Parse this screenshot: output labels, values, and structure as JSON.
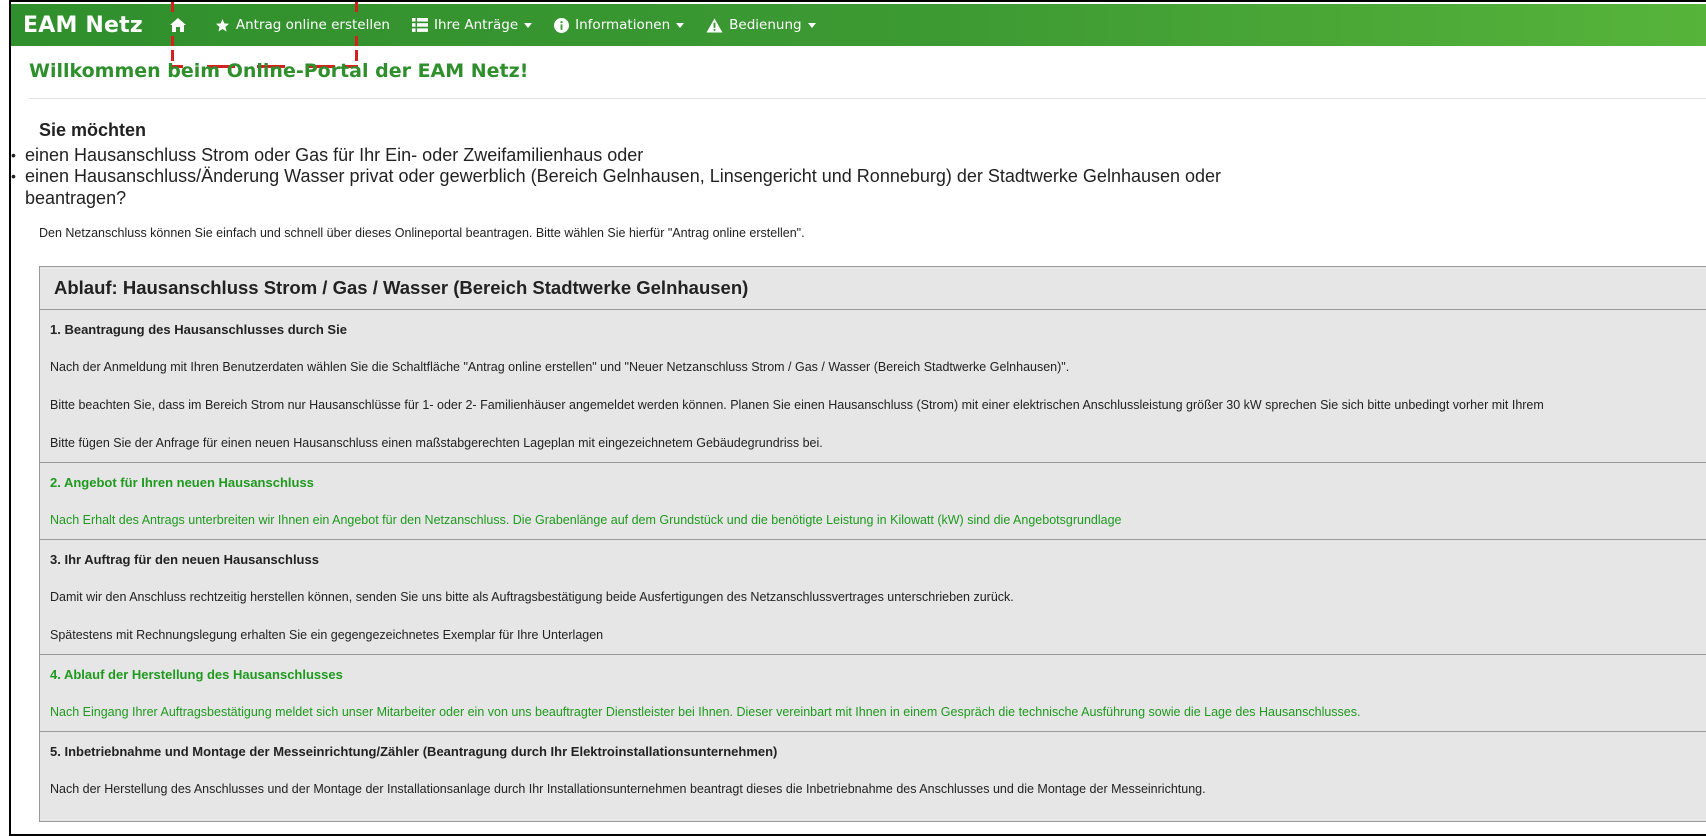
{
  "navbar": {
    "brand": "EAM Netz",
    "items": [
      {
        "icon": "star-icon",
        "label": "Antrag online erstellen"
      },
      {
        "icon": "list-icon",
        "label": "Ihre Anträge"
      },
      {
        "icon": "info-icon",
        "label": "Informationen"
      },
      {
        "icon": "warning-icon",
        "label": "Bedienung"
      }
    ]
  },
  "page": {
    "title": "Willkommen beim Online-Portal der EAM Netz!",
    "intro_heading": "Sie möchten",
    "intro_items": [
      "einen Hausanschluss Strom oder Gas für Ihr Ein- oder Zweifamilienhaus oder",
      "einen Hausanschluss/Änderung Wasser privat oder gewerblich (Bereich Gelnhausen, Linsengericht und Ronneburg) der Stadtwerke Gelnhausen oder"
    ],
    "intro_end": "beantragen?",
    "note": "Den Netzanschluss können Sie einfach und schnell über dieses Onlineportal beantragen. Bitte wählen Sie hierfür \"Antrag online erstellen\"."
  },
  "panel": {
    "title": "Ablauf: Hausanschluss Strom / Gas / Wasser (Bereich Stadtwerke Gelnhausen)",
    "steps": [
      {
        "title": "1. Beantragung des Hausanschlusses durch Sie",
        "paragraphs": [
          "Nach der Anmeldung mit Ihren Benutzerdaten wählen Sie die Schaltfläche \"Antrag online erstellen\" und \"Neuer Netzanschluss Strom / Gas / Wasser (Bereich Stadtwerke Gelnhausen)\".",
          "Bitte beachten Sie, dass im Bereich Strom nur Hausanschlüsse für 1- oder 2- Familienhäuser angemeldet werden können. Planen Sie einen Hausanschluss (Strom) mit einer elektrischen Anschlussleistung größer 30 kW sprechen Sie sich bitte unbedingt vorher mit Ihrem",
          "Bitte fügen Sie der Anfrage für einen neuen Hausanschluss einen maßstabgerechten Lageplan mit eingezeichnetem Gebäudegrundriss bei."
        ]
      },
      {
        "title": "2. Angebot für Ihren neuen Hausanschluss",
        "paragraphs": [
          "Nach Erhalt des Antrags unterbreiten wir Ihnen ein Angebot für den Netzanschluss. Die Grabenlänge auf dem Grundstück und die benötigte Leistung in Kilowatt (kW) sind die Angebotsgrundlage"
        ]
      },
      {
        "title": "3. Ihr Auftrag für den neuen Hausanschluss",
        "paragraphs": [
          "Damit wir den Anschluss rechtzeitig herstellen können, senden Sie uns bitte als Auftragsbestätigung beide Ausfertigungen des Netzanschlussvertrages unterschrieben zurück.",
          "Spätestens mit Rechnungslegung erhalten Sie ein gegengezeichnetes Exemplar für Ihre Unterlagen"
        ]
      },
      {
        "title": "4. Ablauf der Herstellung des Hausanschlusses",
        "paragraphs": [
          "Nach Eingang Ihrer Auftragsbestätigung meldet sich unser Mitarbeiter oder ein von uns beauftragter Dienstleister bei Ihnen. Dieser vereinbart mit Ihnen in einem Gespräch die technische Ausführung sowie die Lage des Hausanschlusses."
        ]
      },
      {
        "title": "5. Inbetriebnahme und Montage der Messeinrichtung/Zähler (Beantragung durch Ihr Elektroinstallationsunternehmen)",
        "paragraphs": [
          "Nach der Herstellung des Anschlusses und der Montage der Installationsanlage durch Ihr Installationsunternehmen beantragt dieses die Inbetriebnahme des Anschlusses und die Montage der Messeinrichtung."
        ]
      }
    ]
  },
  "colors": {
    "nav_green": "#2f8f2c",
    "title_green": "#2f8f2c",
    "step_green": "#1f9a1f",
    "panel_bg": "#e6e6e6",
    "highlight_red": "#d61f1f"
  }
}
